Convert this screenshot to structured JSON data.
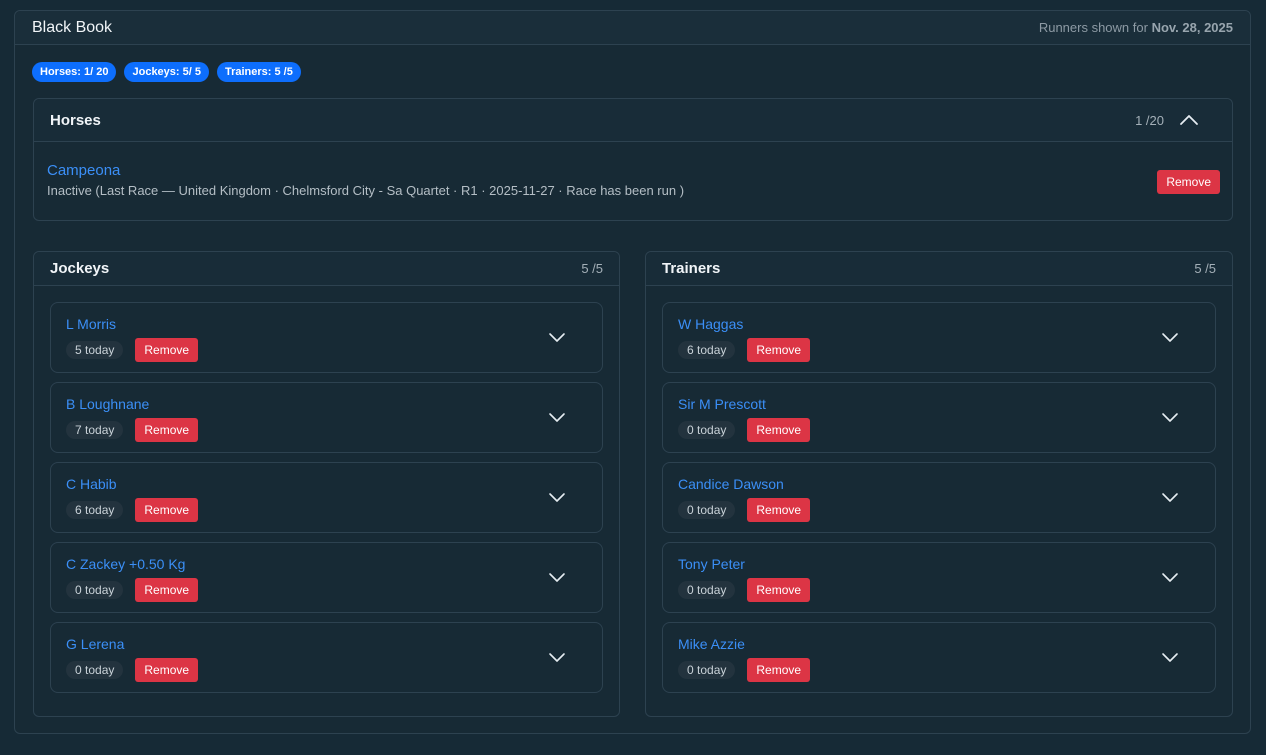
{
  "header": {
    "title": "Black Book",
    "meta_prefix": "Runners shown for",
    "meta_date": "Nov. 28, 2025"
  },
  "badges": [
    {
      "label": "Horses: 1/ 20"
    },
    {
      "label": "Jockeys: 5/ 5"
    },
    {
      "label": "Trainers: 5 /5"
    }
  ],
  "horses": {
    "title": "Horses",
    "count": "1 /20",
    "items": [
      {
        "name": "Campeona",
        "status": "Inactive (Last Race — United Kingdom · Chelmsford City - Sa Quartet · R1 · 2025-11-27 · Race has been run )",
        "remove_label": "Remove"
      }
    ]
  },
  "jockeys": {
    "title": "Jockeys",
    "count": "5 /5",
    "items": [
      {
        "name": "L Morris",
        "today": "5 today",
        "remove_label": "Remove"
      },
      {
        "name": "B Loughnane",
        "today": "7 today",
        "remove_label": "Remove"
      },
      {
        "name": "C Habib",
        "today": "6 today",
        "remove_label": "Remove"
      },
      {
        "name": "C Zackey +0.50 Kg",
        "today": "0 today",
        "remove_label": "Remove"
      },
      {
        "name": "G Lerena",
        "today": "0 today",
        "remove_label": "Remove"
      }
    ]
  },
  "trainers": {
    "title": "Trainers",
    "count": "5 /5",
    "items": [
      {
        "name": "W Haggas",
        "today": "6 today",
        "remove_label": "Remove"
      },
      {
        "name": "Sir M Prescott",
        "today": "0 today",
        "remove_label": "Remove"
      },
      {
        "name": "Candice Dawson",
        "today": "0 today",
        "remove_label": "Remove"
      },
      {
        "name": "Tony Peter",
        "today": "0 today",
        "remove_label": "Remove"
      },
      {
        "name": "Mike Azzie",
        "today": "0 today",
        "remove_label": "Remove"
      }
    ]
  },
  "icons": {
    "collapse": "chevron-up-icon",
    "expand": "chevron-down-icon"
  },
  "colors": {
    "accent": "#0d6efd",
    "link": "#3b8ff7",
    "danger": "#dc3545",
    "background": "#162a36"
  }
}
